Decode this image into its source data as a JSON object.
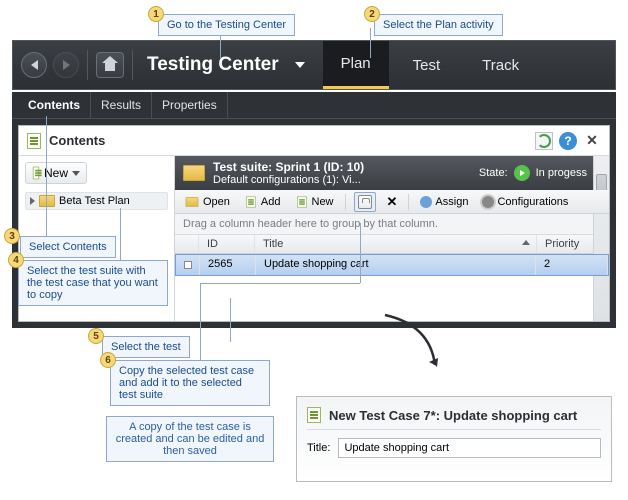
{
  "callouts": {
    "c1": "Go to the Testing Center",
    "c2": "Select the Plan activity",
    "c3": "Select Contents",
    "c4": "Select the test suite with the test case that you want to copy",
    "c5": "Select the test",
    "c6": "Copy the selected test case and add it to the selected test suite",
    "note": "A copy of the test case is created and can be edited and then saved"
  },
  "badges": {
    "b1": "1",
    "b2": "2",
    "b3": "3",
    "b4": "4",
    "b5": "5",
    "b6": "6"
  },
  "ribbon": {
    "center_title": "Testing Center",
    "tabs": {
      "plan": "Plan",
      "test": "Test",
      "track": "Track"
    }
  },
  "subtabs": {
    "contents": "Contents",
    "results": "Results",
    "properties": "Properties"
  },
  "panel": {
    "title": "Contents",
    "new_btn": "New",
    "tree_item": "Beta Test Plan"
  },
  "suite": {
    "title": "Test suite:  Sprint 1 (ID: 10)",
    "subtitle": "Default configurations (1): Vi...",
    "state_label": "State:",
    "state_value": "In progess"
  },
  "toolbar": {
    "open": "Open",
    "add": "Add",
    "new": "New",
    "delete": "✕",
    "assign": "Assign",
    "config": "Configurations"
  },
  "grid": {
    "group_hint": "Drag a column header here to group by that column.",
    "cols": {
      "id": "ID",
      "title": "Title",
      "priority": "Priority"
    },
    "row": {
      "id": "2565",
      "title": "Update shopping cart",
      "priority": "2"
    }
  },
  "newcase": {
    "header": "New Test Case 7*: Update shopping cart",
    "title_label": "Title:",
    "title_value": "Update shopping cart"
  }
}
